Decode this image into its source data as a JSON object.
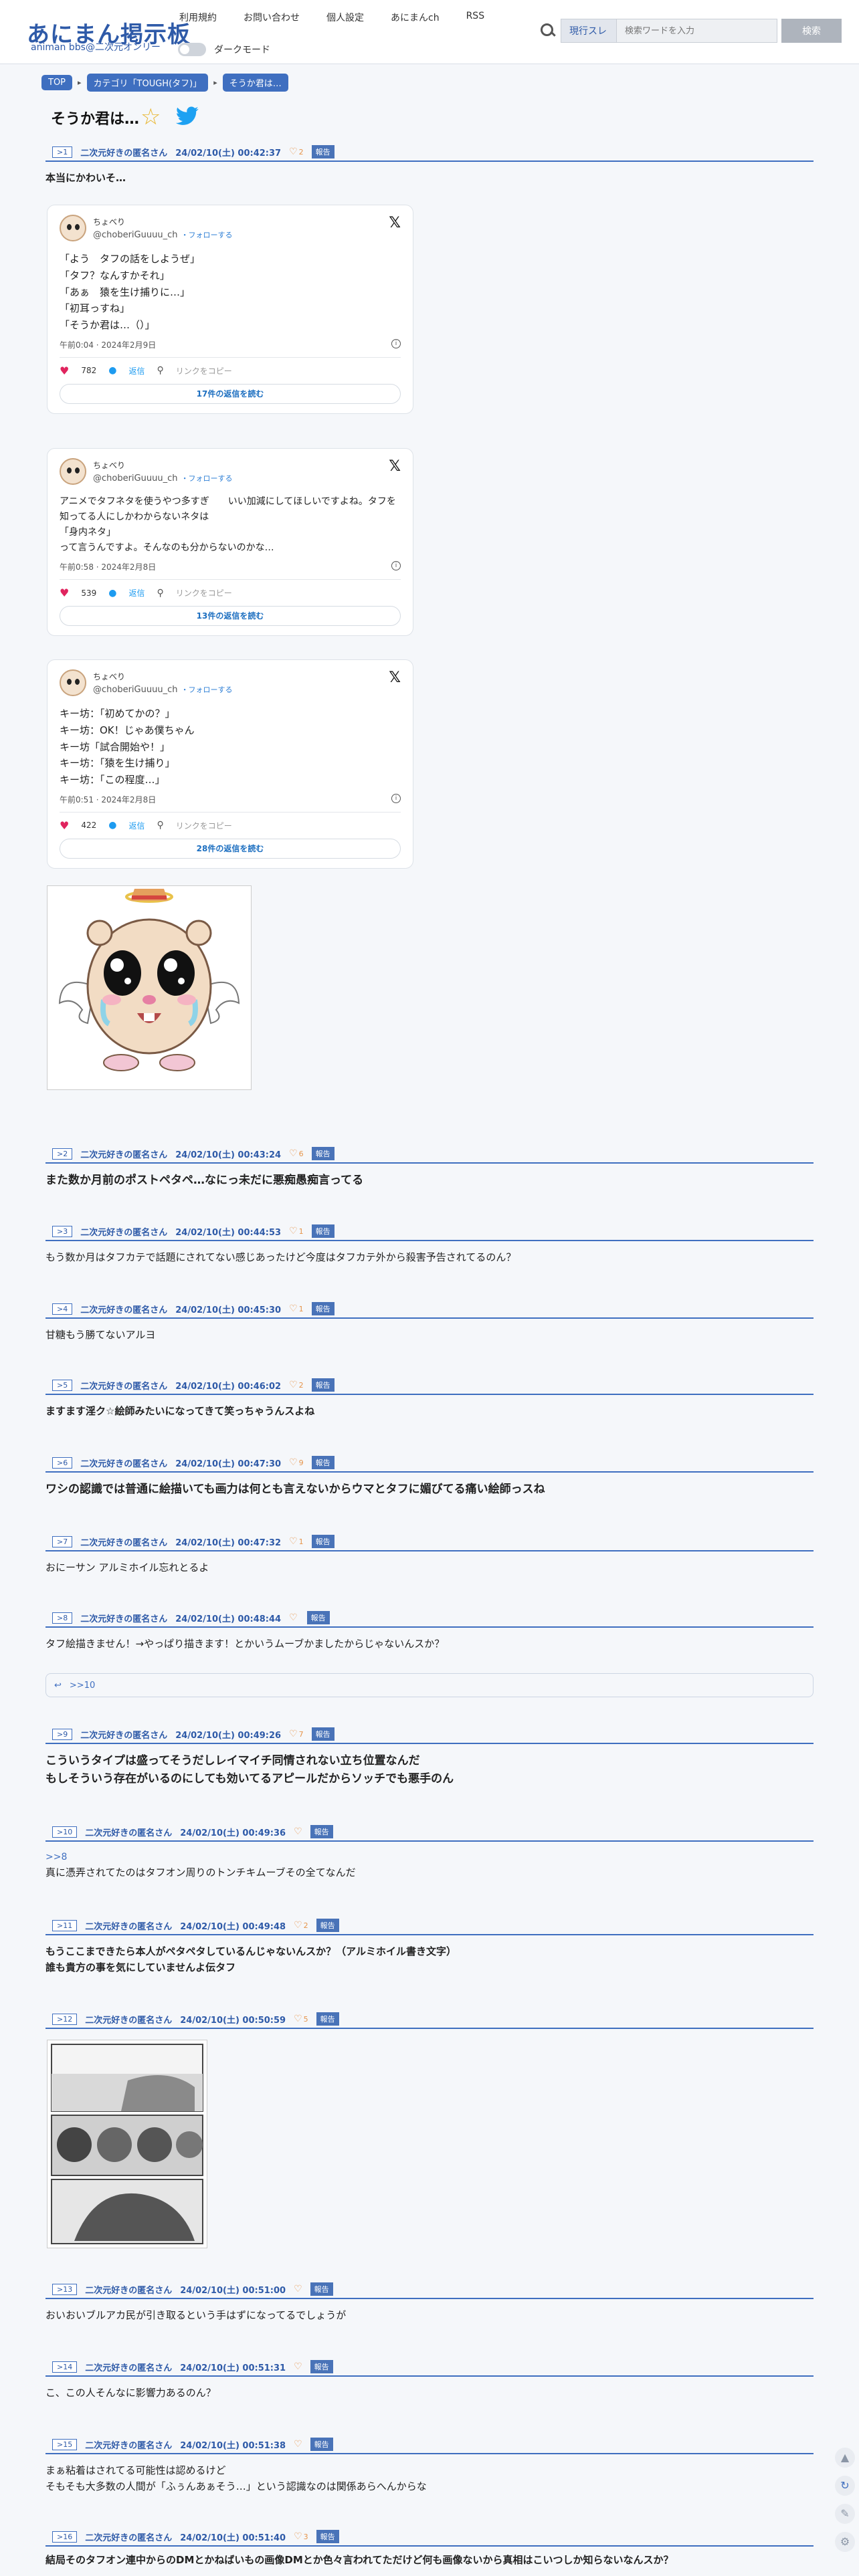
{
  "header": {
    "logo_main": "あにまん掲示板",
    "logo_sub": "animan bbs@二次元オンリー",
    "nav": [
      "利用規約",
      "お問い合わせ",
      "個人設定",
      "あにまんch",
      "RSS"
    ],
    "dark_mode_label": "ダークモード",
    "search_scope": "現行スレ",
    "search_placeholder": "検索ワードを入力",
    "search_button": "検索"
  },
  "breadcrumb": [
    "TOP",
    "カテゴリ「TOUGH(タフ)」",
    "そうか君は…"
  ],
  "thread_title": "そうか君は…",
  "tweets": [
    {
      "name": "ちょべり",
      "handle": "@choberiGuuuu_ch",
      "follow": "・フォローする",
      "lines": [
        "「よう　タフの話をしようぜ」",
        "「タフ？なんすかそれ」",
        "「あぁ　猿を生け捕りに…」",
        "「初耳っすね」",
        "「そうか君は…（）」"
      ],
      "time": "午前0:04 · 2024年2月9日",
      "likes": "782",
      "reply": "返信",
      "copy": "リンクをコピー",
      "more": "17件の返信を読む"
    },
    {
      "name": "ちょべり",
      "handle": "@choberiGuuuu_ch",
      "follow": "・フォローする",
      "lines": [
        "アニメでタフネタを使うやつ多すぎ　　いい加減にしてほしいですよね。タフを知ってる人にしかわからないネタは",
        "「身内ネタ」",
        "って言うんですよ。そんなのも分からないのかな…"
      ],
      "time": "午前0:58 · 2024年2月8日",
      "likes": "539",
      "reply": "返信",
      "copy": "リンクをコピー",
      "more": "13件の返信を読む"
    },
    {
      "name": "ちょべり",
      "handle": "@choberiGuuuu_ch",
      "follow": "・フォローする",
      "lines": [
        "キー坊：「初めてかの？」",
        "キー坊：OK！じゃあ僕ちゃん",
        "キー坊「試合開始や！」",
        "キー坊：「猿を生け捕り」",
        "キー坊：「この程度…」"
      ],
      "time": "午前0:51 · 2024年2月8日",
      "likes": "422",
      "reply": "返信",
      "copy": "リンクをコピー",
      "more": "28件の返信を読む"
    }
  ],
  "posts": [
    {
      "no": ">1",
      "name": "二次元好きの匿名さん",
      "date": "24/02/10(土) 00:42:37",
      "hearts": "2",
      "report": "報告",
      "text": [
        "本当にかわいそ…"
      ]
    },
    {
      "no": ">2",
      "name": "二次元好きの匿名さん",
      "date": "24/02/10(土) 00:43:24",
      "hearts": "6",
      "report": "報告",
      "text": [
        "また数か月前のポストペタペ…なにっ未だに悪痴愚痴言ってる"
      ]
    },
    {
      "no": ">3",
      "name": "二次元好きの匿名さん",
      "date": "24/02/10(土) 00:44:53",
      "hearts": "1",
      "report": "報告",
      "text": [
        "もう数か月はタフカテで話題にされてない感じあったけど今度はタフカテ外から殺害予告されてるのん？"
      ]
    },
    {
      "no": ">4",
      "name": "二次元好きの匿名さん",
      "date": "24/02/10(土) 00:45:30",
      "hearts": "1",
      "report": "報告",
      "text": [
        "甘糖もう勝てないアルヨ"
      ]
    },
    {
      "no": ">5",
      "name": "二次元好きの匿名さん",
      "date": "24/02/10(土) 00:46:02",
      "hearts": "2",
      "report": "報告",
      "text": [
        "ますます淫ク☆絵師みたいになってきて笑っちゃうんスよね"
      ]
    },
    {
      "no": ">6",
      "name": "二次元好きの匿名さん",
      "date": "24/02/10(土) 00:47:30",
      "hearts": "9",
      "report": "報告",
      "text": [
        "ワシの認識では普通に絵描いても画力は何とも言えないからウマとタフに媚びてる痛い絵師っスね"
      ]
    },
    {
      "no": ">7",
      "name": "二次元好きの匿名さん",
      "date": "24/02/10(土) 00:47:32",
      "hearts": "1",
      "report": "報告",
      "text": [
        "おにーサン アルミホイル忘れとるよ"
      ]
    },
    {
      "no": ">8",
      "name": "二次元好きの匿名さん",
      "date": "24/02/10(土) 00:48:44",
      "hearts": "",
      "report": "報告",
      "text": [
        "タフ絵描きません！→やっぱり描きます！とかいうムーブかましたからじゃないんスか？"
      ]
    },
    {
      "no": ">9",
      "name": "二次元好きの匿名さん",
      "date": "24/02/10(土) 00:49:26",
      "hearts": "7",
      "report": "報告",
      "text": [
        "こういうタイプは盛ってそうだしレイマイチ同情されない立ち位置なんだ",
        "もしそういう存在がいるのにしても効いてるアピールだからソッチでも悪手のん"
      ]
    },
    {
      "no": ">10",
      "name": "二次元好きの匿名さん",
      "date": "24/02/10(土) 00:49:36",
      "hearts": "",
      "report": "報告",
      "text": [
        ">>8",
        "真に憑弄されてたのはタフオン周りのトンチキムーブその全てなんだ"
      ]
    },
    {
      "no": ">11",
      "name": "二次元好きの匿名さん",
      "date": "24/02/10(土) 00:49:48",
      "hearts": "2",
      "report": "報告",
      "text": [
        "もうここまできたら本人がペタペタしているんじゃないんスか？（アルミホイル書き文字）",
        "誰も貴方の事を気にしていませんよ伝タフ"
      ]
    },
    {
      "no": ">12",
      "name": "二次元好きの匿名さん",
      "date": "24/02/10(土) 00:50:59",
      "hearts": "5",
      "report": "報告",
      "text": []
    },
    {
      "no": ">13",
      "name": "二次元好きの匿名さん",
      "date": "24/02/10(土) 00:51:00",
      "hearts": "",
      "report": "報告",
      "text": [
        "おいおいブルアカ民が引き取るという手はずになってるでしょうが"
      ]
    },
    {
      "no": ">14",
      "name": "二次元好きの匿名さん",
      "date": "24/02/10(土) 00:51:31",
      "hearts": "",
      "report": "報告",
      "text": [
        "こ、この人そんなに影響力あるのん？"
      ]
    },
    {
      "no": ">15",
      "name": "二次元好きの匿名さん",
      "date": "24/02/10(土) 00:51:38",
      "hearts": "",
      "report": "報告",
      "text": [
        "まぁ粘着はされてる可能性は認めるけど",
        "そもそも大多数の人間が「ふぅんあぁそう…」という認識なのは関係あらへんからな"
      ]
    },
    {
      "no": ">16",
      "name": "二次元好きの匿名さん",
      "date": "24/02/10(土) 00:51:40",
      "hearts": "3",
      "report": "報告",
      "text": [
        "結局そのタフオン連中からのDMとかねばいもの画像DMとか色々言われてただけど何も画像ないから真相はこいつしか知らないなんスか？"
      ]
    }
  ],
  "reply_bar": {
    "icon": "reply-arrow-icon",
    "anchor": ">>10"
  },
  "colors": {
    "accent": "#3f6fc0",
    "heart": "#e6944a",
    "tweet_heart": "#e0245e"
  }
}
